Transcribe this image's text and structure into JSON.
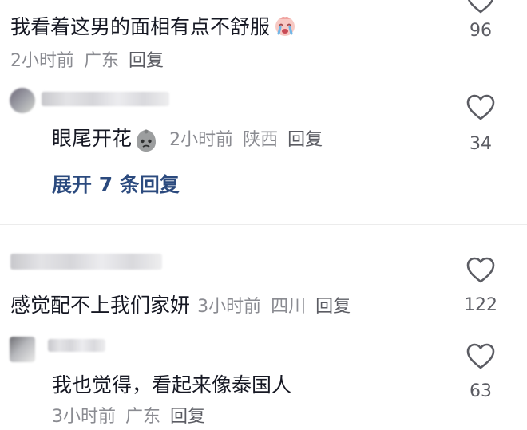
{
  "comments": [
    {
      "text": "我看着这男的面相有点不舒服",
      "emoji": "crying-face-emoji",
      "time": "2小时前",
      "location": "广东",
      "reply": "回复",
      "likes": "96"
    },
    {
      "text": "眼尾开花",
      "emoji": "sad-face-emoji",
      "time": "2小时前",
      "location": "陕西",
      "reply": "回复",
      "likes": "34",
      "expand": "展开 7 条回复"
    },
    {
      "text": "感觉配不上我们家妍",
      "time": "3小时前",
      "location": "四川",
      "reply": "回复",
      "likes": "122"
    },
    {
      "text": "我也觉得，看起来像泰国人",
      "time": "3小时前",
      "location": "广东",
      "reply": "回复",
      "likes": "63"
    }
  ],
  "colors": {
    "text": "#161823",
    "meta": "#8a8b91",
    "expand": "#2b4a7e",
    "heart": "#5b5c63"
  }
}
